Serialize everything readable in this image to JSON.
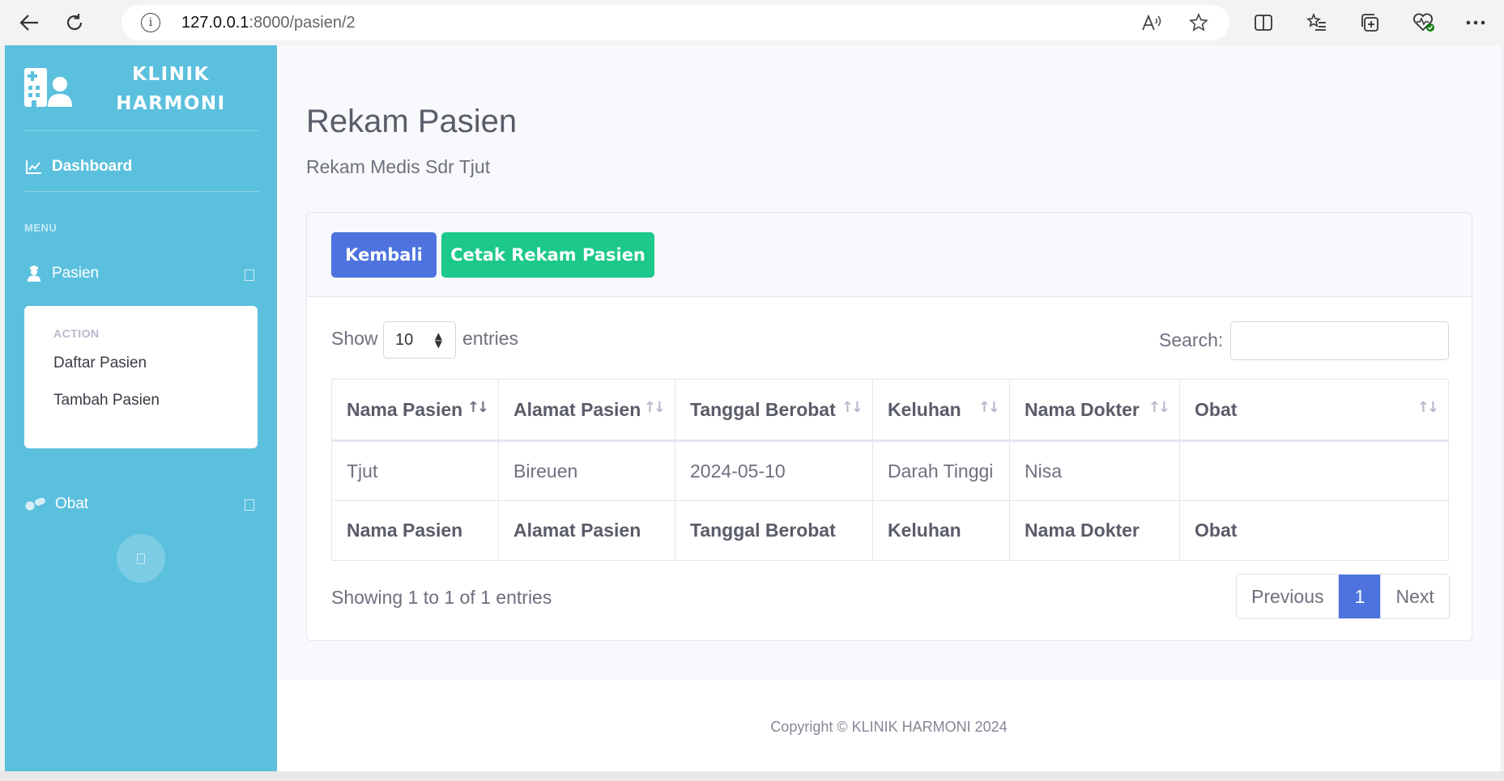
{
  "browser": {
    "url_host": "127.0.0.1",
    "url_path": ":8000/pasien/2"
  },
  "sidebar": {
    "brand_line1": "KLINIK",
    "brand_line2": "HARMONI",
    "dashboard_label": "Dashboard",
    "menu_heading": "MENU",
    "pasien_label": "Pasien",
    "submenu_heading": "ACTION",
    "submenu_items": [
      "Daftar Pasien",
      "Tambah Pasien"
    ],
    "obat_label": "Obat"
  },
  "page": {
    "title": "Rekam Pasien",
    "subtitle": "Rekam Medis Sdr Tjut"
  },
  "card": {
    "back_label": "Kembali",
    "print_label": "Cetak Rekam Pasien",
    "show_label": "Show",
    "page_size": "10",
    "entries_label": "entries",
    "search_label": "Search:",
    "search_value": ""
  },
  "table": {
    "columns": [
      "Nama Pasien",
      "Alamat Pasien",
      "Tanggal Berobat",
      "Keluhan",
      "Nama Dokter",
      "Obat"
    ],
    "rows": [
      [
        "Tjut",
        "Bireuen",
        "2024-05-10",
        "Darah Tinggi",
        "Nisa",
        ""
      ]
    ],
    "footer_columns": [
      "Nama Pasien",
      "Alamat Pasien",
      "Tanggal Berobat",
      "Keluhan",
      "Nama Dokter",
      "Obat"
    ],
    "info": "Showing 1 to 1 of 1 entries",
    "pagination": {
      "previous": "Previous",
      "current": "1",
      "next": "Next"
    }
  },
  "footer": {
    "copyright": "Copyright © KLINIK HARMONI 2024"
  },
  "colors": {
    "sidebar": "#5bc0de",
    "primary": "#4e73df",
    "success": "#1cc88a"
  }
}
